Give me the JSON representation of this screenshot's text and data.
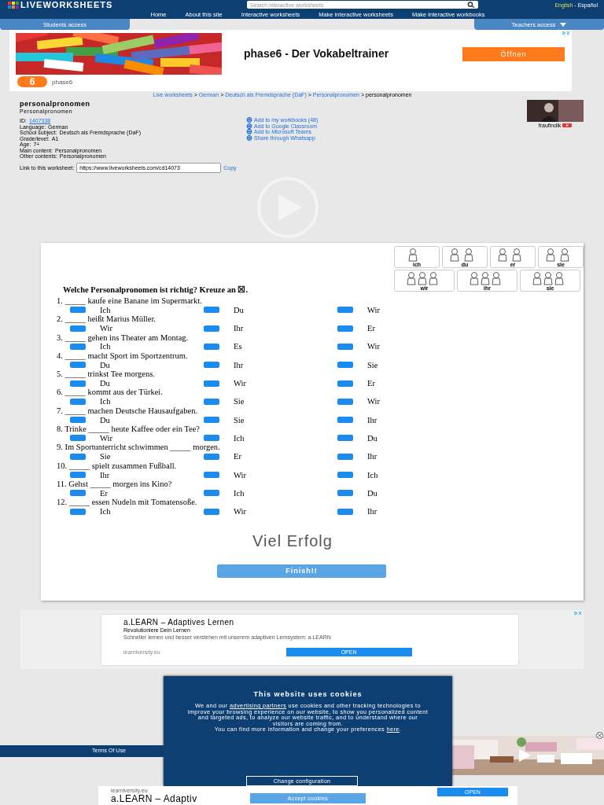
{
  "header": {
    "logo": "LIVEWORKSHEETS",
    "search": {
      "placeholder": "Search interactive worksheets"
    },
    "languages": [
      {
        "label": "English",
        "selected": true
      },
      {
        "label": "Español",
        "selected": false
      }
    ],
    "language_separator": "-",
    "nav": [
      "Home",
      "About this site",
      "Interactive worksheets",
      "Make interactive worksheets",
      "Make interactive workbooks"
    ],
    "access_tabs": [
      {
        "label": "Students access",
        "caret": false
      },
      {
        "label": "Teachers access",
        "caret": true
      }
    ]
  },
  "ad_top": {
    "headline": "phase6 - Der Vokabeltrainer",
    "button": "Öffnen",
    "logo_text": "6",
    "brand": "phase6"
  },
  "breadcrumb": {
    "links": [
      "Live worksheets",
      "German",
      "Deutsch als Fremdsprache (DaF)",
      "Personalpronomen"
    ],
    "separator": ">",
    "current": "personalpronomen"
  },
  "worksheet_info": {
    "title": "personalpronomen",
    "subtitle": "Personalpronomen",
    "details": [
      {
        "label": "ID:",
        "value": "1407338",
        "link": true
      },
      {
        "label": "Language:",
        "value": "German",
        "link": false
      },
      {
        "label": "School subject:",
        "value": "Deutsch als Fremdsprache (DaF)",
        "link": false
      },
      {
        "label": "Grade/level:",
        "value": "A1",
        "link": false
      },
      {
        "label": "Age:",
        "value": "7+",
        "link": false
      },
      {
        "label": "Main content:",
        "value": "Personalpronomen",
        "link": false
      },
      {
        "label": "Other contents:",
        "value": "Personalpronomen",
        "link": false
      }
    ],
    "actions": [
      "Add to my workbooks (48)",
      "Add to Google Classroom",
      "Add to Microsoft Teams",
      "Share through Whatsapp"
    ],
    "author": "fraufindik",
    "link_label": "Link to this worksheet:",
    "link_value": "https://www.liveworksheets.com/cd14073",
    "copy": "Copy"
  },
  "worksheet": {
    "heading": "Welche Personalpronomen ist richtig? Kreuze an ☒.",
    "picture_labels": [
      [
        "ich",
        "du",
        "er",
        "sie"
      ],
      [
        "wir",
        "ihr",
        "sie"
      ]
    ],
    "questions": [
      {
        "text": "1. _____ kaufe eine Banane im Supermarkt.",
        "options": [
          {
            "label": "Ich",
            "checked": false
          },
          {
            "label": "Du",
            "checked": false
          },
          {
            "label": "Wir",
            "checked": false
          }
        ]
      },
      {
        "text": "2. _____ heißt Marius Müller.",
        "options": [
          {
            "label": "Wir",
            "checked": false
          },
          {
            "label": "Ihr",
            "checked": false
          },
          {
            "label": "Er",
            "checked": false
          }
        ]
      },
      {
        "text": "3. _____ gehen ins Theater am Montag.",
        "options": [
          {
            "label": "Ich",
            "checked": false
          },
          {
            "label": "Es",
            "checked": false
          },
          {
            "label": "Wir",
            "checked": false
          }
        ]
      },
      {
        "text": "4. _____ macht Sport im Sportzentrum.",
        "options": [
          {
            "label": "Du",
            "checked": false
          },
          {
            "label": "Ihr",
            "checked": false
          },
          {
            "label": "Sie",
            "checked": false
          }
        ]
      },
      {
        "text": "5. _____ trinkst Tee morgens.",
        "options": [
          {
            "label": "Du",
            "checked": false
          },
          {
            "label": "Wir",
            "checked": false
          },
          {
            "label": "Er",
            "checked": false
          }
        ]
      },
      {
        "text": "6. _____ kommt aus der Türkei.",
        "options": [
          {
            "label": "Ich",
            "checked": false
          },
          {
            "label": "Sie",
            "checked": false
          },
          {
            "label": "Wir",
            "checked": false
          }
        ]
      },
      {
        "text": "7. _____ machen Deutsche Hausaufgaben.",
        "options": [
          {
            "label": "Du",
            "checked": false
          },
          {
            "label": "Sie",
            "checked": false
          },
          {
            "label": "Ihr",
            "checked": false
          }
        ]
      },
      {
        "text": "8. Trinke _____ heute Kaffee oder ein Tee?",
        "options": [
          {
            "label": "Wir",
            "checked": false
          },
          {
            "label": "Ich",
            "checked": false
          },
          {
            "label": "Du",
            "checked": false
          }
        ]
      },
      {
        "text": "9. Im Sportunterricht schwimmen _____ morgen.",
        "options": [
          {
            "label": "Sie",
            "checked": false
          },
          {
            "label": "Er",
            "checked": false
          },
          {
            "label": "Ihr",
            "checked": false
          }
        ]
      },
      {
        "text": "10. _____ spielt zusammen Fußball.",
        "options": [
          {
            "label": "Ihr",
            "checked": false
          },
          {
            "label": "Wir",
            "checked": false
          },
          {
            "label": "Ich",
            "checked": false
          }
        ]
      },
      {
        "text": "11. Gehst _____ morgen ins Kino?",
        "options": [
          {
            "label": "Er",
            "checked": false
          },
          {
            "label": "Ich",
            "checked": false
          },
          {
            "label": "Du",
            "checked": false
          }
        ]
      },
      {
        "text": "12. _____ essen Nudeln mit Tomatensoße.",
        "options": [
          {
            "label": "Ich",
            "checked": false
          },
          {
            "label": "Wir",
            "checked": false
          },
          {
            "label": "Ihr",
            "checked": false
          }
        ]
      }
    ],
    "closing": "Viel Erfolg",
    "finish": "Finish!!"
  },
  "ad_bottom": {
    "headline": "a.LEARN – Adaptives Lernen",
    "subheadline": "Revolutioniere Dein Lernen",
    "body": "Schneller lernen und besser verstehen mit unserem adaptiven Lernsystem: a.LEARN",
    "domain": "learniversity.eu",
    "button": "OPEN"
  },
  "footer": {
    "link": "Terms Of Use"
  },
  "cookie_dialog": {
    "title": "This website uses cookies",
    "paragraphs": [
      [
        {
          "kind": "text",
          "text": "We and our "
        },
        {
          "kind": "link",
          "text": "advertising partners"
        },
        {
          "kind": "text",
          "text": " use cookies and other tracking technologies to improve your browsing experience on our website, to show you personalized content and targeted ads, to analyze our website traffic, and to understand where our visitors are coming from."
        }
      ],
      [
        {
          "kind": "text",
          "text": "You can find more information and change your preferences "
        },
        {
          "kind": "link",
          "text": "here"
        },
        {
          "kind": "text",
          "text": "."
        }
      ]
    ],
    "buttons": [
      {
        "label": "Change configuration",
        "primary": false
      },
      {
        "label": "Accept cookies",
        "primary": true
      }
    ]
  },
  "sticky_ad": {
    "domain": "learniversity.eu",
    "headline": "a.LEARN – Adaptiv",
    "button": "OPEN"
  }
}
